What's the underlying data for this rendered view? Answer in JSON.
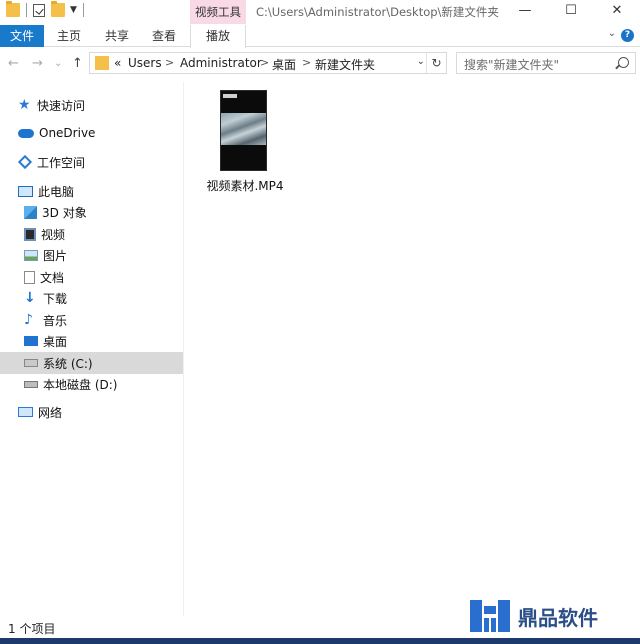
{
  "window": {
    "contextual_tab_group": "视频工具",
    "title_path": "C:\\Users\\Administrator\\Desktop\\新建文件夹",
    "controls": {
      "minimize": "—",
      "maximize": "☐",
      "close": "✕"
    }
  },
  "ribbon": {
    "tabs": [
      {
        "label": "文件"
      },
      {
        "label": "主页"
      },
      {
        "label": "共享"
      },
      {
        "label": "查看"
      },
      {
        "label": "播放"
      }
    ],
    "expand_glyph": "⌄",
    "help_glyph": "?"
  },
  "nav": {
    "back": "←",
    "forward": "→",
    "recent": "⌄",
    "up": "↑"
  },
  "address": {
    "overflow": "«",
    "crumbs": [
      "Users",
      "Administrator",
      "桌面",
      "新建文件夹"
    ],
    "separator": ">",
    "dropdown": "⌄",
    "refresh": "↻"
  },
  "search": {
    "placeholder": "搜索\"新建文件夹\""
  },
  "sidebar": {
    "items": [
      {
        "label": "快速访问",
        "icon": "quick-access-icon"
      },
      {
        "label": "OneDrive",
        "icon": "onedrive-icon"
      },
      {
        "label": "工作空间",
        "icon": "workspace-icon"
      },
      {
        "label": "此电脑",
        "icon": "this-pc-icon"
      },
      {
        "label": "3D 对象",
        "icon": "3d-objects-icon"
      },
      {
        "label": "视频",
        "icon": "videos-icon"
      },
      {
        "label": "图片",
        "icon": "pictures-icon"
      },
      {
        "label": "文档",
        "icon": "documents-icon"
      },
      {
        "label": "下载",
        "icon": "downloads-icon"
      },
      {
        "label": "音乐",
        "icon": "music-icon"
      },
      {
        "label": "桌面",
        "icon": "desktop-icon"
      },
      {
        "label": "系统 (C:)",
        "icon": "drive-c-icon",
        "selected": true
      },
      {
        "label": "本地磁盘 (D:)",
        "icon": "drive-d-icon"
      },
      {
        "label": "网络",
        "icon": "network-icon"
      }
    ]
  },
  "files": [
    {
      "name": "视频素材.MP4",
      "type": "video-file-icon"
    }
  ],
  "status": {
    "item_count": "1 个项目"
  },
  "watermark": {
    "text": "鼎品软件"
  }
}
